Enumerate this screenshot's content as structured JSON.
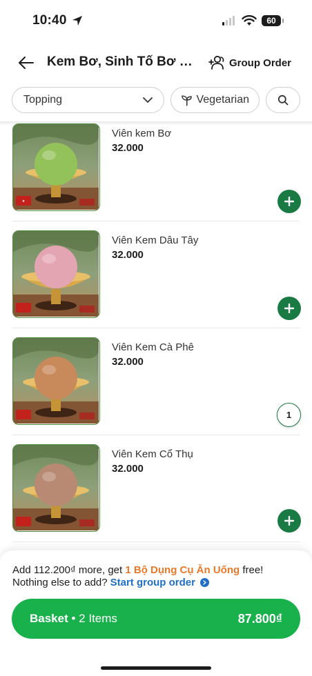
{
  "status_bar": {
    "time": "10:40",
    "battery": "60"
  },
  "header": {
    "title": "Kem Bơ, Sinh Tố Bơ H...",
    "group_order_label": "Group Order"
  },
  "filters": {
    "topping_label": "Topping",
    "vegetarian_label": "Vegetarian"
  },
  "items": [
    {
      "name": "Viên kem Bơ",
      "price": "32.000",
      "scoop_color": "#93c15a",
      "in_basket": false
    },
    {
      "name": "Viên Kem Dâu Tây",
      "price": "32.000",
      "scoop_color": "#e4a5b3",
      "in_basket": false
    },
    {
      "name": "Viên Kem Cà Phê",
      "price": "32.000",
      "scoop_color": "#c98a5b",
      "in_basket": true,
      "quantity": "1"
    },
    {
      "name": "Viên Kem Cổ Thụ",
      "price": "32.000",
      "scoop_color": "#b88a73",
      "in_basket": false
    }
  ],
  "promo": {
    "prefix": "Add 112.200₫ more, get ",
    "highlight": "1 Bộ Dụng Cụ Ăn Uống",
    "suffix": " free!",
    "line2_prefix": "Nothing else to add?",
    "line2_link": "Start group order"
  },
  "basket": {
    "label": "Basket",
    "separator": " • ",
    "items_text": "2 Items",
    "total": "87.800₫"
  },
  "colors": {
    "brand_green": "#18b14b",
    "add_button_green": "#1a7a44",
    "promo_orange": "#e8792a",
    "link_blue": "#1f6fc6"
  }
}
